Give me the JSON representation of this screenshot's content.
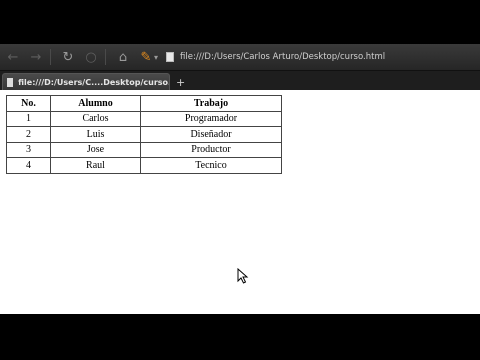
{
  "toolbar": {
    "back_icon": "back-arrow-icon",
    "forward_icon": "forward-arrow-icon",
    "reload_icon": "reload-icon",
    "stop_icon": "stop-icon",
    "home_icon": "home-icon",
    "edit_icon": "pen-icon",
    "url": "file:///D:/Users/Carlos Arturo/Desktop/curso.html"
  },
  "tabs": [
    {
      "title": "file:///D:/Users/C....Desktop/curso.html",
      "active": true
    }
  ],
  "new_tab_label": "+",
  "table": {
    "headers": [
      "No.",
      "Alumno",
      "Trabajo"
    ],
    "rows": [
      [
        "1",
        "Carlos",
        "Programador"
      ],
      [
        "2",
        "Luis",
        "Diseñador"
      ],
      [
        "3",
        "Jose",
        "Productor"
      ],
      [
        "4",
        "Raul",
        "Tecnico"
      ]
    ]
  },
  "colors": {
    "accent": "#e08a1e",
    "toolbar_bg": "#2f2f2f",
    "page_bg": "#ffffff"
  }
}
